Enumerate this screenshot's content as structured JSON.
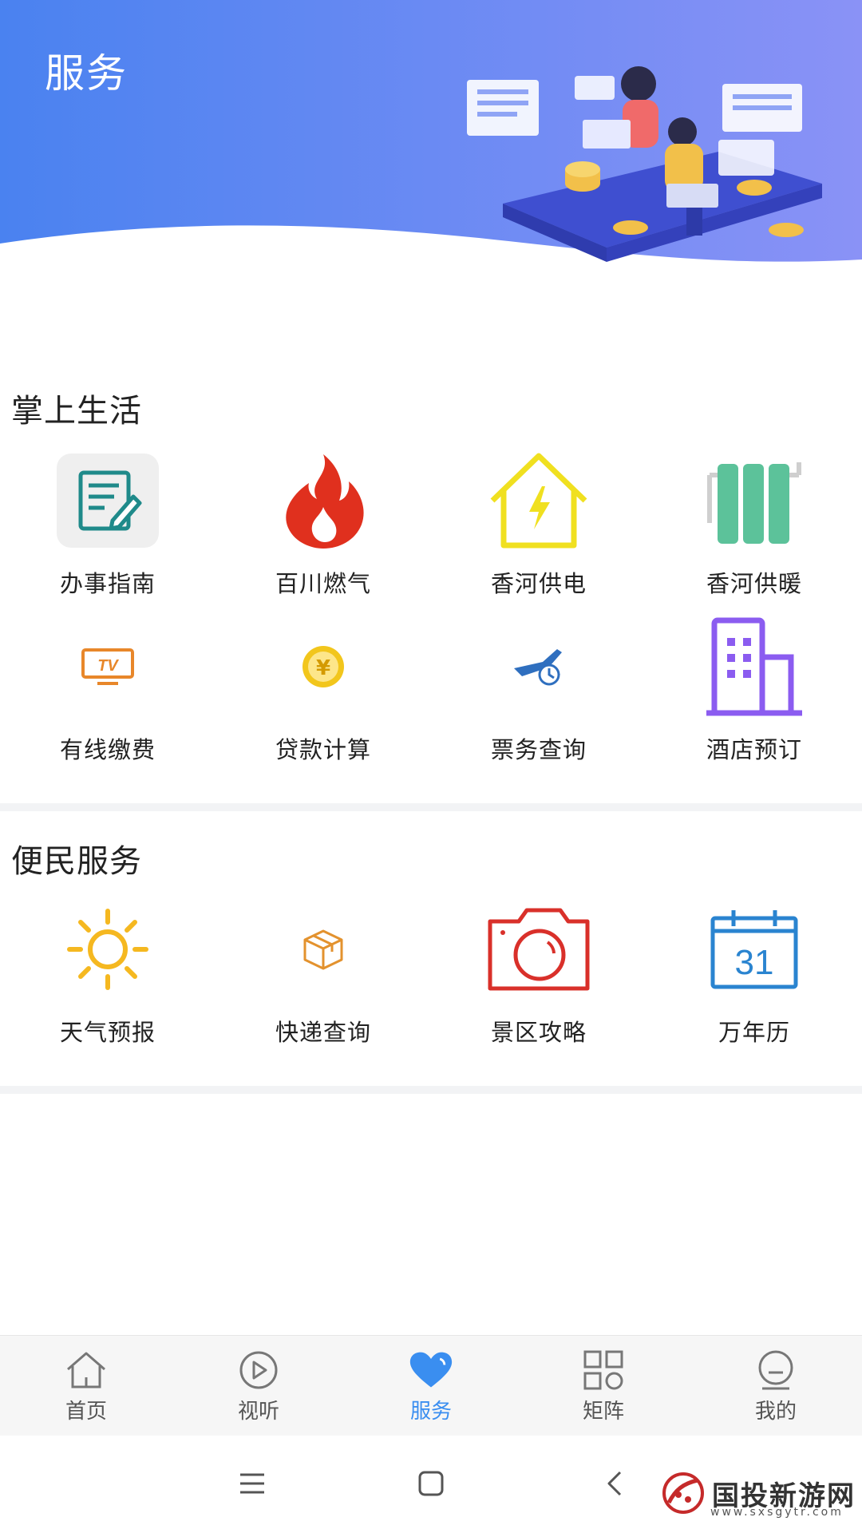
{
  "header": {
    "title": "服务"
  },
  "sections": [
    {
      "title": "掌上生活",
      "items": [
        {
          "label": "办事指南",
          "icon": "guide-document-icon"
        },
        {
          "label": "百川燃气",
          "icon": "gas-flame-icon"
        },
        {
          "label": "香河供电",
          "icon": "power-house-icon"
        },
        {
          "label": "香河供暖",
          "icon": "radiator-icon"
        },
        {
          "label": "有线缴费",
          "icon": "tv-icon"
        },
        {
          "label": "贷款计算",
          "icon": "yuan-coin-icon"
        },
        {
          "label": "票务查询",
          "icon": "airplane-clock-icon"
        },
        {
          "label": "酒店预订",
          "icon": "hotel-building-icon"
        }
      ]
    },
    {
      "title": "便民服务",
      "items": [
        {
          "label": "天气预报",
          "icon": "sun-icon"
        },
        {
          "label": "快递查询",
          "icon": "package-icon"
        },
        {
          "label": "景区攻略",
          "icon": "camera-icon"
        },
        {
          "label": "万年历",
          "icon": "calendar-icon",
          "calendar_day": "31"
        }
      ]
    }
  ],
  "tabbar": {
    "active_index": 2,
    "active_color": "#3a8ef0",
    "items": [
      {
        "label": "首页",
        "icon": "home-icon"
      },
      {
        "label": "视听",
        "icon": "play-icon"
      },
      {
        "label": "服务",
        "icon": "heart-icon"
      },
      {
        "label": "矩阵",
        "icon": "grid-icon"
      },
      {
        "label": "我的",
        "icon": "user-face-icon"
      }
    ]
  },
  "watermark": {
    "text": "国投新游网",
    "url": "www.sxsgytr.com"
  },
  "colors": {
    "header_gradient_start": "#4a82f0",
    "header_gradient_end": "#8a92f6",
    "flame": "#e0301e",
    "power": "#f0e020",
    "radiator": "#5cc29a",
    "tv": "#e8872a",
    "coin": "#f2c61c",
    "plane": "#2f6fbf",
    "hotel": "#8b5cf0",
    "sun": "#f5b820",
    "package": "#e3922e",
    "camera": "#d9302a",
    "calendar": "#2a84d0"
  }
}
